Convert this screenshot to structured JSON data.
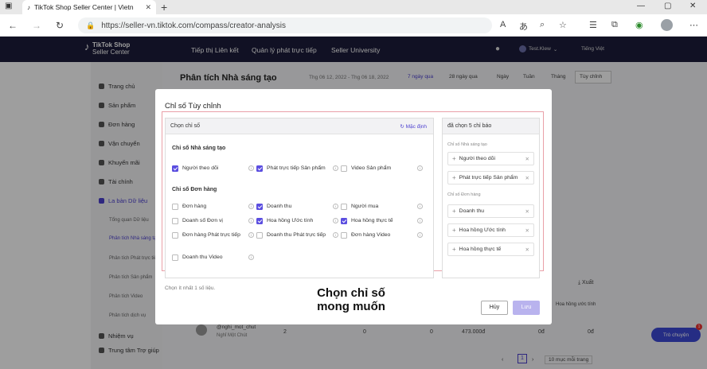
{
  "browser": {
    "tab_title": "TikTok Shop Seller Center | Vietn",
    "url": "https://seller-vn.tiktok.com/compass/creator-analysis"
  },
  "header": {
    "logo_line1": "TikTok Shop",
    "logo_line2": "Seller Center",
    "nav": [
      "Tiếp thị Liên kết",
      "Quản lý phát trực tiếp",
      "Seller University"
    ],
    "user": "Test.Klew",
    "language": "Tiếng Việt"
  },
  "sidebar": {
    "items": [
      "Trang chủ",
      "Sản phẩm",
      "Đơn hàng",
      "Vận chuyển",
      "Khuyến mãi",
      "Tài chính",
      "La bàn Dữ liệu"
    ],
    "sub_items": [
      "Tổng quan Dữ liệu",
      "Phân tích Nhà sáng tạo",
      "Phân tích Phát trực tiếp",
      "Phân tích Sản phẩm",
      "Phân tích Video",
      "Phân tích dịch vụ"
    ],
    "bottom_items": [
      "Nhiệm vụ",
      "Trung tâm Trợ giúp"
    ]
  },
  "page": {
    "title": "Phân tích Nhà sáng tạo",
    "date_range": "Thg 06 12, 2022 - Thg 06 18, 2022",
    "range_tabs": [
      "7 ngày qua",
      "28 ngày qua",
      "Ngày",
      "Tuần",
      "Tháng",
      "Tùy chỉnh"
    ],
    "export_label": "Xuất",
    "table_header": "Hoa hồng ước tính",
    "row_name": "@nghi_mot_chut",
    "row_sub": "Nghỉ Một Chút",
    "row_values": [
      "2",
      "0",
      "0",
      "473.000đ",
      "0đ",
      "0đ"
    ],
    "pagination_current": "1",
    "page_size": "10 mục mỗi trang",
    "chat_label": "Trò chuyện",
    "chat_badge": "1"
  },
  "modal": {
    "title": "Chỉ số Tùy chỉnh",
    "left_head": "Chọn chỉ số",
    "reset_label": "Mặc định",
    "section_creator": "Chỉ số Nhà sáng tạo",
    "section_order": "Chỉ số Đơn hàng",
    "creator_metrics": [
      {
        "label": "Người theo dõi",
        "checked": true
      },
      {
        "label": "Phát trực tiếp Sản phẩm",
        "checked": true
      },
      {
        "label": "Video Sản phẩm",
        "checked": false
      }
    ],
    "order_metrics": [
      {
        "label": "Đơn hàng",
        "checked": false
      },
      {
        "label": "Doanh thu",
        "checked": true
      },
      {
        "label": "Người mua",
        "checked": false
      },
      {
        "label": "Doanh số Đơn vị",
        "checked": false
      },
      {
        "label": "Hoa hồng Ước tính",
        "checked": true
      },
      {
        "label": "Hoa hồng thực tế",
        "checked": true
      },
      {
        "label": "Đơn hàng Phát trực tiếp",
        "checked": false
      },
      {
        "label": "Doanh thu Phát trực tiếp",
        "checked": false
      },
      {
        "label": "Đơn hàng Video",
        "checked": false
      },
      {
        "label": "Doanh thu Video",
        "checked": false
      }
    ],
    "right_head": "đã chọn 5 chỉ báo",
    "right_group_creator": "Chỉ số Nhà sáng tạo",
    "right_group_order": "Chỉ số Đơn hàng",
    "selected": [
      "Người theo dõi",
      "Phát trực tiếp Sản phẩm",
      "Doanh thu",
      "Hoa hồng Ước tính",
      "Hoa hồng thực tế"
    ],
    "footnote": "Chọn ít nhất 1 số liệu.",
    "cancel_label": "Hủy",
    "save_label": "Lưu"
  },
  "caption": {
    "line1": "Chọn chỉ số",
    "line2": "mong muốn"
  },
  "colors": {
    "accent": "#5b4ee0",
    "header_bg": "#1c1c3a",
    "frame_red": "#e9a0a8"
  }
}
